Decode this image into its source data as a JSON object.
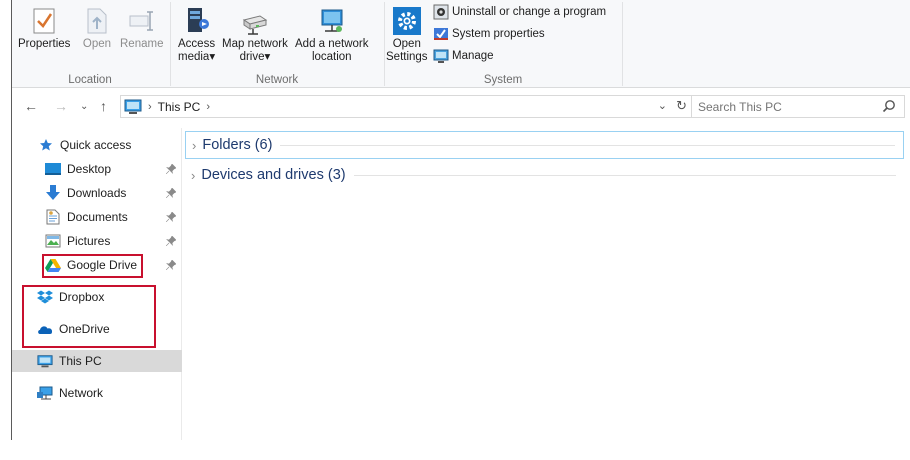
{
  "ribbon": {
    "location": {
      "caption": "Location",
      "properties": "Properties",
      "open": "Open",
      "rename": "Rename"
    },
    "network": {
      "caption": "Network",
      "access_media": [
        "Access",
        "media▾"
      ],
      "map_network_drive": [
        "Map network",
        "drive▾"
      ],
      "add_network_location": [
        "Add a network",
        "location"
      ]
    },
    "system": {
      "caption": "System",
      "open_settings": [
        "Open",
        "Settings"
      ],
      "uninstall": "Uninstall or change a program",
      "system_properties": "System properties",
      "manage": "Manage"
    }
  },
  "address": {
    "crumb": "This PC",
    "search_placeholder": "Search This PC"
  },
  "navpane": {
    "quick_access": "Quick access",
    "items": [
      "Desktop",
      "Downloads",
      "Documents",
      "Pictures",
      "Google Drive"
    ],
    "dropbox": "Dropbox",
    "onedrive": "OneDrive",
    "this_pc": "This PC",
    "network": "Network"
  },
  "content": {
    "folders": "Folders (6)",
    "devices": "Devices and drives (3)"
  },
  "colors": {
    "highlight_box": "#c8102e",
    "selected_row": "#d9d9d9",
    "section_text": "#1e3a6e",
    "focus_border": "#99d1f2"
  }
}
